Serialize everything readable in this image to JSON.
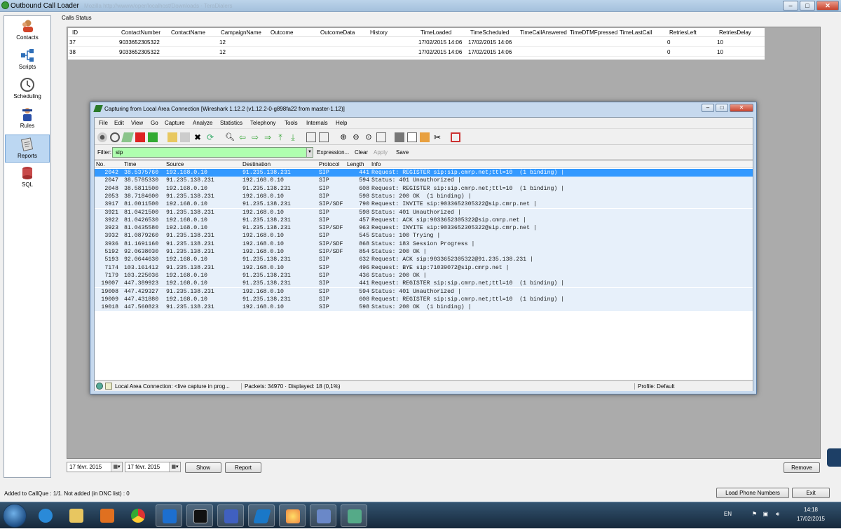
{
  "window": {
    "title": "Outbound Call Loader",
    "faded_title": "Mozilla  http://wwww/oper/localhost/Downloads  ·  TeraDialers"
  },
  "sidebar": {
    "items": [
      {
        "label": "Contacts",
        "icon": "contacts-icon"
      },
      {
        "label": "Scripts",
        "icon": "scripts-icon"
      },
      {
        "label": "Scheduling",
        "icon": "clock-icon"
      },
      {
        "label": "Rules",
        "icon": "rules-icon"
      },
      {
        "label": "Reports",
        "icon": "reports-icon",
        "active": true
      },
      {
        "label": "SQL",
        "icon": "database-icon"
      }
    ]
  },
  "calls": {
    "label": "Calls Status",
    "columns": [
      "ID",
      "ContactNumber",
      "ContactName",
      "CampaignName",
      "Outcome",
      "OutcomeData",
      "History",
      "TimeLoaded",
      "TimeScheduled",
      "TimeCallAnswered",
      "TimeDTMFpressed",
      "TimeLastCall",
      "RetriesLeft",
      "RetriesDelay"
    ],
    "rows": [
      [
        "37",
        "9033652305322",
        "",
        "12",
        "",
        "",
        "",
        "17/02/2015 14:06",
        "17/02/2015 14:06",
        "",
        "",
        "",
        "0",
        "10"
      ],
      [
        "38",
        "9033652305322",
        "",
        "12",
        "",
        "",
        "",
        "17/02/2015 14:06",
        "17/02/2015 14:06",
        "",
        "",
        "",
        "0",
        "10"
      ]
    ]
  },
  "controls": {
    "date_from": "17 févr. 2015",
    "date_to": "17 févr. 2015",
    "show": "Show",
    "report": "Report",
    "remove": "Remove",
    "load": "Load Phone Numbers",
    "exit": "Exit",
    "status": "Added to CallQue : 1/1. Not added (in DNC list) : 0"
  },
  "wireshark": {
    "title": "Capturing from Local Area Connection   [Wireshark 1.12.2  (v1.12.2-0-g898fa22 from master-1.12)]",
    "menu": [
      "File",
      "Edit",
      "View",
      "Go",
      "Capture",
      "Analyze",
      "Statistics",
      "Telephony",
      "Tools",
      "Internals",
      "Help"
    ],
    "filter_label": "Filter:",
    "filter_value": "sip",
    "filter_buttons": [
      "Expression...",
      "Clear",
      "Apply",
      "Save"
    ],
    "columns": [
      "No.",
      "Time",
      "Source",
      "Destination",
      "Protocol",
      "Length",
      "Info"
    ],
    "packets": [
      [
        "2042",
        "38.5375760",
        "192.168.0.10",
        "91.235.138.231",
        "SIP",
        "441",
        "Request: REGISTER sip:sip.cmrp.net;ttl=10  (1 binding) |"
      ],
      [
        "2047",
        "38.5785330",
        "91.235.138.231",
        "192.168.0.10",
        "SIP",
        "594",
        "Status: 401 Unauthorized |"
      ],
      [
        "2048",
        "38.5811500",
        "192.168.0.10",
        "91.235.138.231",
        "SIP",
        "608",
        "Request: REGISTER sip:sip.cmrp.net;ttl=10  (1 binding) |"
      ],
      [
        "2053",
        "38.7184600",
        "91.235.138.231",
        "192.168.0.10",
        "SIP",
        "598",
        "Status: 200 OK  (1 binding) |"
      ],
      [
        "3917",
        "81.0011500",
        "192.168.0.10",
        "91.235.138.231",
        "SIP/SDF",
        "790",
        "Request: INVITE sip:9033652305322@sip.cmrp.net |"
      ],
      [
        "3921",
        "81.0421500",
        "91.235.138.231",
        "192.168.0.10",
        "SIP",
        "598",
        "Status: 401 Unauthorized |"
      ],
      [
        "3922",
        "81.0426530",
        "192.168.0.10",
        "91.235.138.231",
        "SIP",
        "457",
        "Request: ACK sip:9033652305322@sip.cmrp.net |"
      ],
      [
        "3923",
        "81.0435580",
        "192.168.0.10",
        "91.235.138.231",
        "SIP/SDF",
        "963",
        "Request: INVITE sip:9033652305322@sip.cmrp.net |"
      ],
      [
        "3932",
        "81.0879260",
        "91.235.138.231",
        "192.168.0.10",
        "SIP",
        "545",
        "Status: 100 Trying |"
      ],
      [
        "3936",
        "81.1691160",
        "91.235.138.231",
        "192.168.0.10",
        "SIP/SDF",
        "868",
        "Status: 183 Session Progress |"
      ],
      [
        "5192",
        "92.0638030",
        "91.235.138.231",
        "192.168.0.10",
        "SIP/SDF",
        "854",
        "Status: 200 OK |"
      ],
      [
        "5193",
        "92.0644630",
        "192.168.0.10",
        "91.235.138.231",
        "SIP",
        "632",
        "Request: ACK sip:9033652305322@91.235.138.231 |"
      ],
      [
        "7174",
        "103.161412",
        "91.235.138.231",
        "192.168.0.10",
        "SIP",
        "496",
        "Request: BYE sip:71039072@sip.cmrp.net |"
      ],
      [
        "7179",
        "103.225036",
        "192.168.0.10",
        "91.235.138.231",
        "SIP",
        "436",
        "Status: 200 OK |"
      ],
      [
        "19007",
        "447.389923",
        "192.168.0.10",
        "91.235.138.231",
        "SIP",
        "441",
        "Request: REGISTER sip:sip.cmrp.net;ttl=10  (1 binding) |"
      ],
      [
        "19008",
        "447.429327",
        "91.235.138.231",
        "192.168.0.10",
        "SIP",
        "594",
        "Status: 401 Unauthorized |"
      ],
      [
        "19009",
        "447.431880",
        "192.168.0.10",
        "91.235.138.231",
        "SIP",
        "608",
        "Request: REGISTER sip:sip.cmrp.net;ttl=10  (1 binding) |"
      ],
      [
        "19018",
        "447.560823",
        "91.235.138.231",
        "192.168.0.10",
        "SIP",
        "598",
        "Status: 200 OK  (1 binding) |"
      ]
    ],
    "status": {
      "interface": "Local Area Connection: <live capture in prog...",
      "packets": "Packets: 34970 · Displayed: 18 (0,1%)",
      "profile": "Profile: Default"
    }
  },
  "taskbar": {
    "lang": "EN",
    "time": "14:18",
    "date": "17/02/2015"
  }
}
